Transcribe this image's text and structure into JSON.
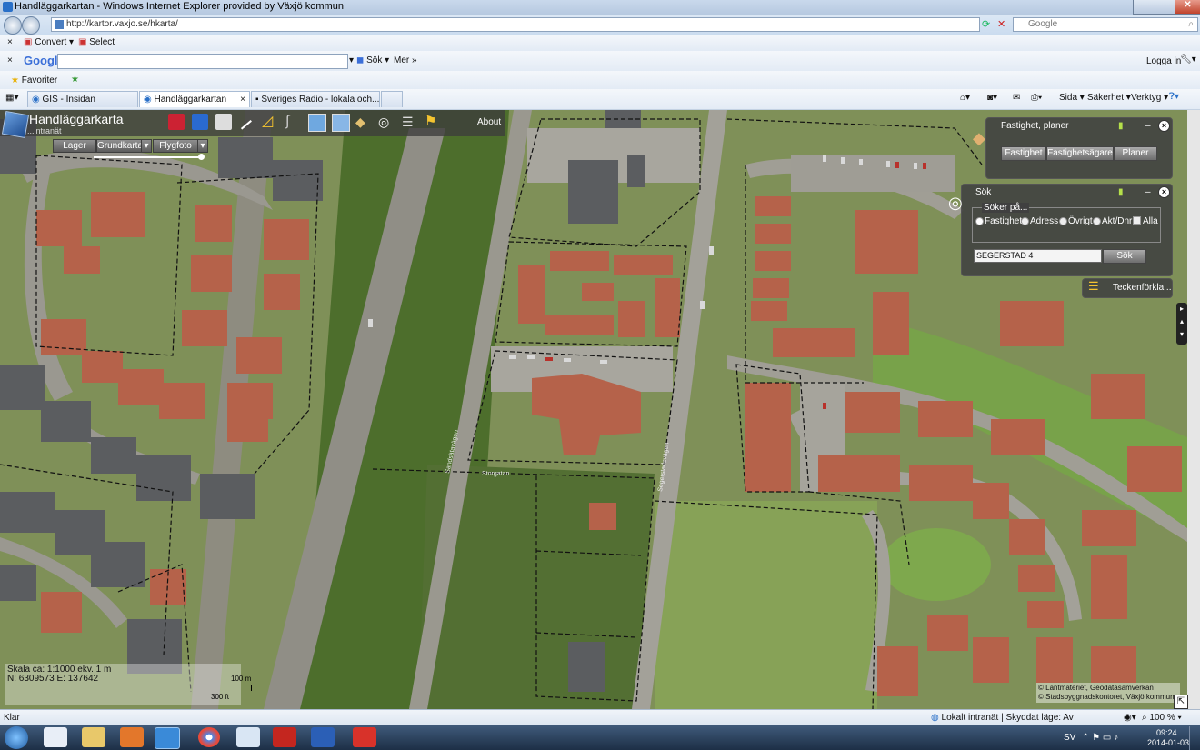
{
  "window": {
    "title": "Handläggarkartan - Windows Internet Explorer provided by Växjö kommun"
  },
  "address": {
    "url": "http://kartor.vaxjo.se/hkarta/",
    "search_placeholder": "Google"
  },
  "toolbar1": {
    "convert": "Convert",
    "select": "Select"
  },
  "google_bar": {
    "logo": "Google",
    "search": "Sök",
    "more": "Mer",
    "login": "Logga in"
  },
  "favorites": {
    "label": "Favoriter"
  },
  "tabs": [
    {
      "label": "GIS - Insidan"
    },
    {
      "label": "Handläggarkartan"
    },
    {
      "label": "Sveriges Radio - lokala och..."
    }
  ],
  "ie_commands": {
    "page": "Sida",
    "security": "Säkerhet",
    "tools": "Verktyg"
  },
  "app": {
    "title": "Handläggarkarta",
    "subtitle": "...intranät",
    "about": "About",
    "layer_buttons": [
      "Lager",
      "Grundkarta",
      "Flygfoto"
    ]
  },
  "panel_property": {
    "title": "Fastighet, planer",
    "buttons": [
      "Fastighet",
      "Fastighetsägare",
      "Planer"
    ]
  },
  "panel_search": {
    "title": "Sök",
    "group_label": "Söker på...",
    "options": [
      "Fastighet",
      "Adress",
      "Övrigt",
      "Akt/Dnr"
    ],
    "checkbox": "Alla",
    "input_value": "SEGERSTAD 4",
    "button": "Sök"
  },
  "legend_button": "Teckenförkla...",
  "map_info": {
    "scale": "Skala ca: 1:1000 ekv. 1 m",
    "coords": "N: 6309573  E: 137642",
    "bar_m": "100 m",
    "bar_ft": "300 ft"
  },
  "copyright": [
    "© Lantmäteriet, Geodatasamverkan",
    "© Stadsbyggnadskontoret, Växjö kommun"
  ],
  "street_labels": [
    "Sandsätavägen",
    "Segerstadsvägen",
    "Storgatan"
  ],
  "status": {
    "left": "Klar",
    "zone": "Lokalt intranät | Skyddat läge: Av",
    "zoom": "100 %"
  },
  "clock": {
    "lang": "SV",
    "time": "09:24",
    "date": "2014-01-03"
  },
  "colors": {
    "app_header": "#3c3c3c",
    "panel": "#404040",
    "roof": "#b5624a"
  }
}
